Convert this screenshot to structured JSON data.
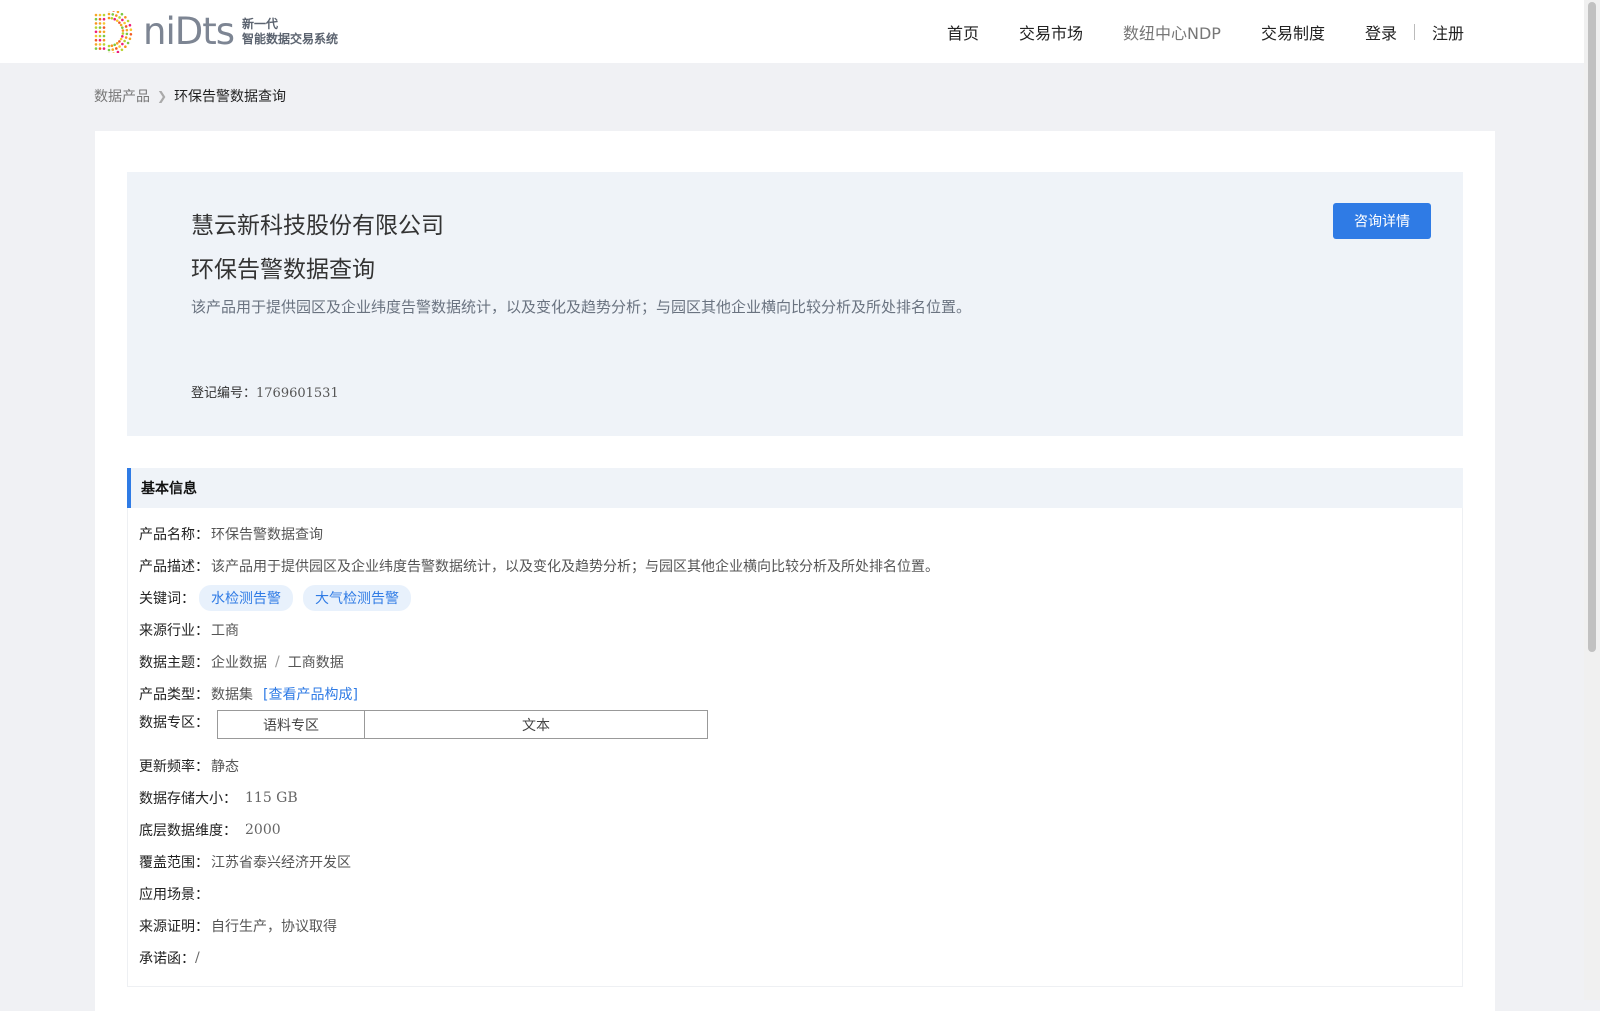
{
  "header": {
    "logo_word": "niDts",
    "logo_tag_line1": "新一代",
    "logo_tag_line2": "智能数据交易系统",
    "nav": {
      "home": "首页",
      "market": "交易市场",
      "ndp": "数纽中心NDP",
      "rules": "交易制度",
      "login": "登录",
      "register": "注册"
    }
  },
  "breadcrumb": {
    "root": "数据产品",
    "current": "环保告警数据查询"
  },
  "product": {
    "company": "慧云新科技股份有限公司",
    "name": "环保告警数据查询",
    "description": "该产品用于提供园区及企业纬度告警数据统计，以及变化及趋势分析；与园区其他企业横向比较分析及所处排名位置。",
    "reg_label": "登记编号：",
    "reg_number": "1769601531",
    "consult_button": "咨询详情"
  },
  "basic_info": {
    "title": "基本信息",
    "product_name_label": "产品名称：",
    "product_name": "环保告警数据查询",
    "product_desc_label": "产品描述：",
    "product_desc": "该产品用于提供园区及企业纬度告警数据统计，以及变化及趋势分析；与园区其他企业横向比较分析及所处排名位置。",
    "keywords_label": "关键词：",
    "keywords": [
      "水检测告警",
      "大气检测告警"
    ],
    "industry_label": "来源行业：",
    "industry": "工商",
    "subject_label": "数据主题：",
    "subject_primary": "企业数据",
    "subject_sep": "/",
    "subject_secondary": "工商数据",
    "type_label": "产品类型：",
    "type": "数据集",
    "type_link": "[查看产品构成]",
    "zone_label": "数据专区：",
    "zone_name": "语料专区",
    "zone_type": "文本",
    "frequency_label": "更新频率：",
    "frequency": "静态",
    "storage_label": "数据存储大小：",
    "storage": "115 GB",
    "dimension_label": "底层数据维度：",
    "dimension": "2000",
    "coverage_label": "覆盖范围：",
    "coverage": "江苏省泰兴经济开发区",
    "scenario_label": "应用场景：",
    "scenario": "",
    "proof_label": "来源证明：",
    "proof": "自行生产，协议取得",
    "commitment_label": "承诺函：",
    "commitment": "/"
  },
  "colors": {
    "accent": "#2f7be5",
    "page_bg": "#f0f1f4",
    "panel_bg": "#eff3f8"
  }
}
